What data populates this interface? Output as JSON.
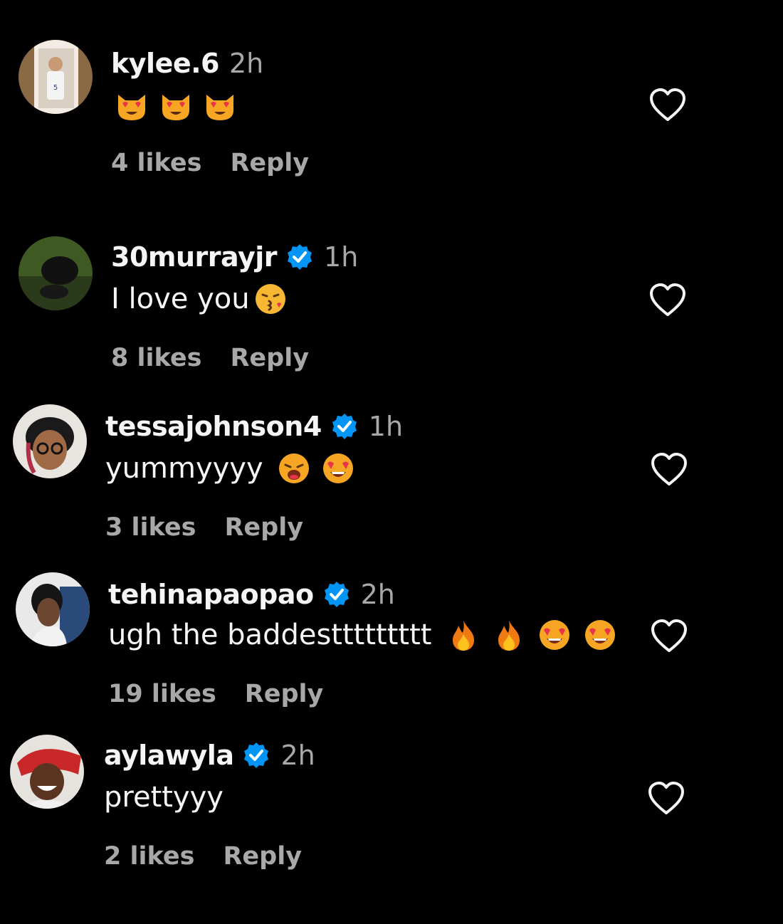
{
  "comments": [
    {
      "username": "kylee.6",
      "verified": false,
      "time": "2h",
      "text": "",
      "emojis": [
        "heart-eyes-cat-icon",
        "heart-eyes-cat-icon",
        "heart-eyes-cat-icon"
      ],
      "likes": "4 likes",
      "reply": "Reply"
    },
    {
      "username": "30murrayjr",
      "verified": true,
      "time": "1h",
      "text": "I love you",
      "emojis": [
        "kissing-face-icon"
      ],
      "likes": "8 likes",
      "reply": "Reply"
    },
    {
      "username": "tessajohnson4",
      "verified": true,
      "time": "1h",
      "text": "yummyyyy",
      "emojis": [
        "weary-face-icon",
        "heart-eyes-face-icon"
      ],
      "likes": "3 likes",
      "reply": "Reply"
    },
    {
      "username": "tehinapaopao",
      "verified": true,
      "time": "2h",
      "text": "ugh the baddesttttttttt",
      "emojis": [
        "fire-icon",
        "fire-icon",
        "heart-eyes-face-icon",
        "heart-eyes-face-icon"
      ],
      "likes": "19 likes",
      "reply": "Reply"
    },
    {
      "username": "aylawyla",
      "verified": true,
      "time": "2h",
      "text": "prettyyy",
      "emojis": [],
      "likes": "2 likes",
      "reply": "Reply"
    }
  ],
  "colors": {
    "background": "#000000",
    "primary_text": "#f5f5f5",
    "secondary_text": "#a8a8a8",
    "verified_blue": "#0095f6"
  }
}
